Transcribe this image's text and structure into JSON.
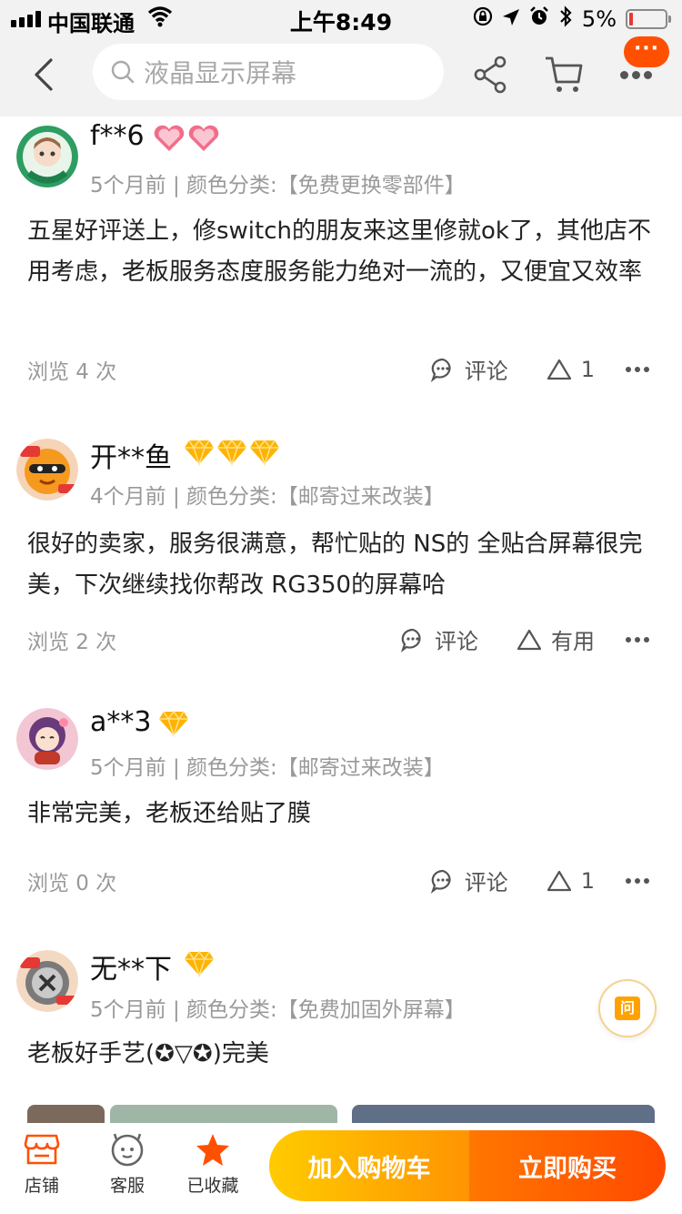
{
  "status_bar": {
    "carrier": "中国联通",
    "time": "上午8:49",
    "battery": "5%",
    "icons": [
      "signal-icon",
      "wifi-icon",
      "lock-rotation-icon",
      "location-icon",
      "alarm-icon",
      "bluetooth-icon",
      "battery-icon"
    ]
  },
  "nav": {
    "search_placeholder": "液晶显示屏幕",
    "badge": "···",
    "icons": [
      "back-icon",
      "search-icon",
      "share-icon",
      "cart-icon",
      "more-icon"
    ]
  },
  "reviews": [
    {
      "username": "f**6",
      "badge_type": "heart",
      "badge_count": 2,
      "meta": "5个月前 | 颜色分类:【免费更换零部件】",
      "content": "五星好评送上，修switch的朋友来这里修就ok了，其他店不用考虑，老板服务态度服务能力绝对一流的，又便宜又效率",
      "views": "浏览 4 次",
      "comment_label": "评论",
      "like_label": "1"
    },
    {
      "username": "开**鱼",
      "badge_type": "diamond",
      "badge_count": 3,
      "meta": "4个月前 | 颜色分类:【邮寄过来改装】",
      "content": "很好的卖家，服务很满意，帮忙贴的 NS的 全贴合屏幕很完美，下次继续找你帮改 RG350的屏幕哈",
      "views": "浏览 2 次",
      "comment_label": "评论",
      "like_label": "有用"
    },
    {
      "username": "a**3",
      "badge_type": "diamond",
      "badge_count": 1,
      "meta": "5个月前 | 颜色分类:【邮寄过来改装】",
      "content": "非常完美，老板还给贴了膜",
      "views": "浏览 0 次",
      "comment_label": "评论",
      "like_label": "1"
    },
    {
      "username": "无**下",
      "badge_type": "diamond",
      "badge_count": 1,
      "meta": "5个月前 | 颜色分类:【免费加固外屏幕】",
      "content": "老板好手艺(✪▽✪)完美"
    }
  ],
  "ask_button": {
    "label": "问"
  },
  "bottom_bar": {
    "shop_label": "店铺",
    "service_label": "客服",
    "favorite_label": "已收藏",
    "add_cart_label": "加入购物车",
    "buy_now_label": "立即购买"
  },
  "colors": {
    "accent_orange": "#ff5000",
    "cart_gradient_start": "#ffcb00",
    "buy_gradient_end": "#ff4900",
    "meta_gray": "#999999",
    "nav_bg": "#f2f2f2"
  }
}
